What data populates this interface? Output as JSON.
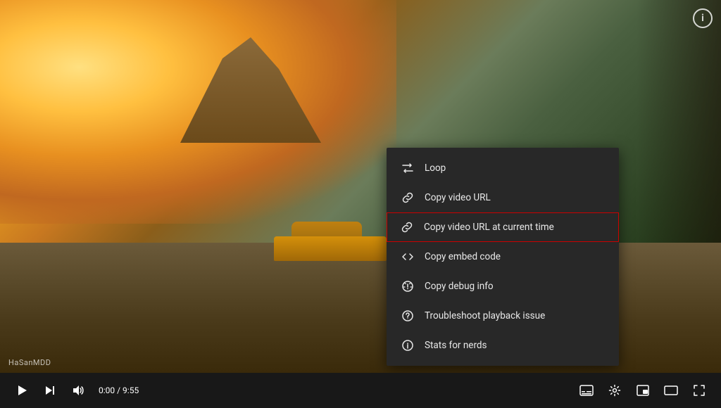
{
  "video": {
    "watermark": "HaSanMDD",
    "time_current": "0:00",
    "time_total": "9:55",
    "time_display": "0:00 / 9:55"
  },
  "info_icon": "i",
  "context_menu": {
    "items": [
      {
        "id": "loop",
        "label": "Loop",
        "icon": "loop"
      },
      {
        "id": "copy-url",
        "label": "Copy video URL",
        "icon": "link"
      },
      {
        "id": "copy-url-time",
        "label": "Copy video URL at current time",
        "icon": "link",
        "highlighted": true
      },
      {
        "id": "copy-embed",
        "label": "Copy embed code",
        "icon": "embed"
      },
      {
        "id": "copy-debug",
        "label": "Copy debug info",
        "icon": "debug"
      },
      {
        "id": "troubleshoot",
        "label": "Troubleshoot playback issue",
        "icon": "question"
      },
      {
        "id": "stats",
        "label": "Stats for nerds",
        "icon": "info"
      }
    ]
  },
  "controls": {
    "play_label": "Play",
    "next_label": "Next",
    "volume_label": "Volume",
    "subtitles_label": "Subtitles",
    "settings_label": "Settings",
    "miniplayer_label": "Miniplayer",
    "theater_label": "Theater mode",
    "fullscreen_label": "Fullscreen"
  }
}
